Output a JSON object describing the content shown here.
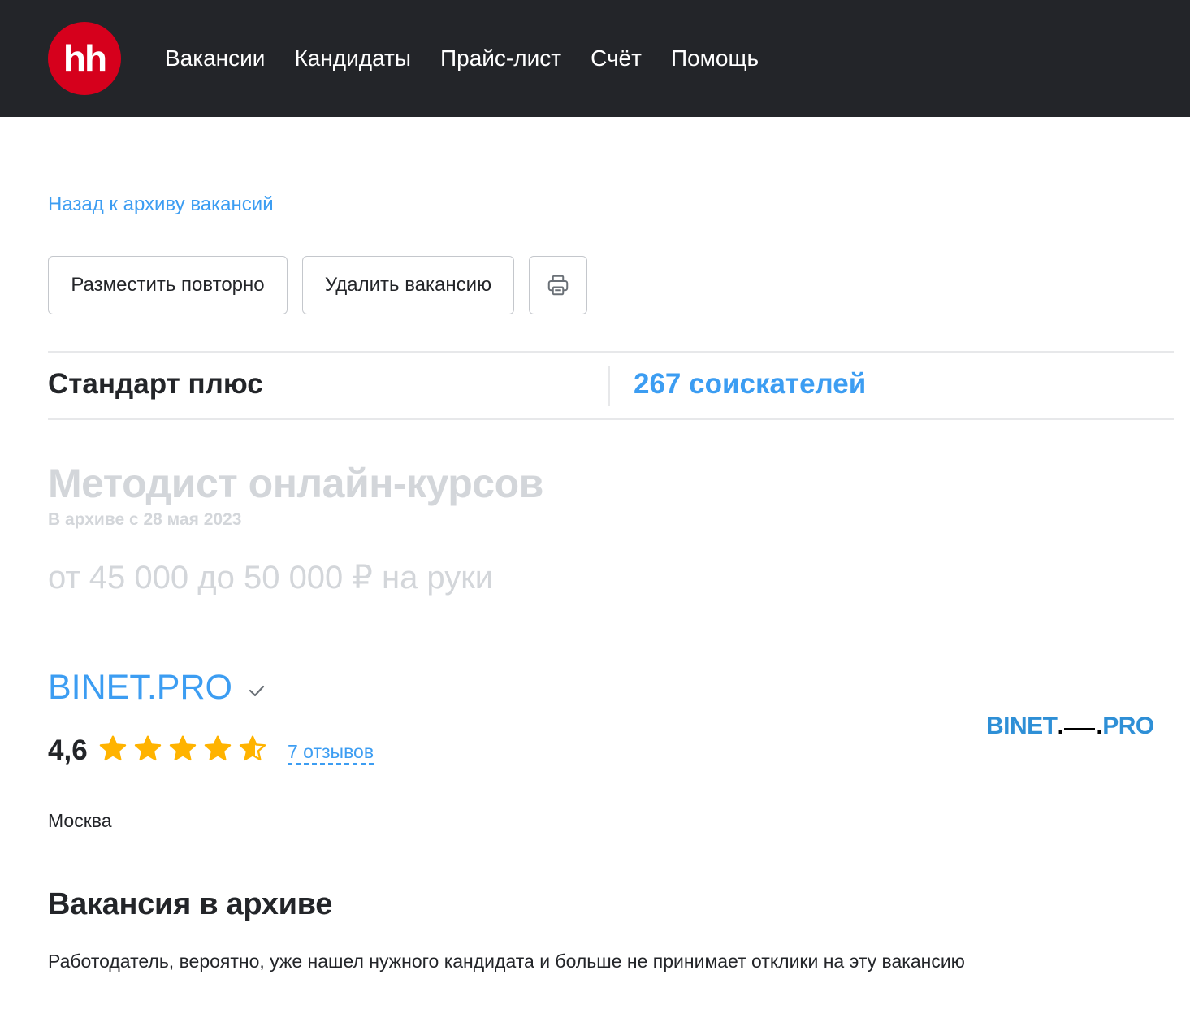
{
  "header": {
    "logo_text": "hh",
    "nav": [
      "Вакансии",
      "Кандидаты",
      "Прайс-лист",
      "Счёт",
      "Помощь"
    ]
  },
  "back_link": "Назад к архиву вакансий",
  "actions": {
    "repost": "Разместить повторно",
    "delete": "Удалить вакансию",
    "print_icon": "printer-icon"
  },
  "tariff": {
    "name": "Стандарт плюс",
    "applicants": "267 соискателей"
  },
  "vacancy": {
    "title": "Методист онлайн-курсов",
    "archive_date": "В архиве с 28 мая 2023",
    "salary": "от 45 000 до 50 000 ₽ на руки"
  },
  "company": {
    "name": "BINET.PRO",
    "verified_icon": "checkmark-icon",
    "rating": "4,6",
    "rating_value": 4.6,
    "stars_max": 5,
    "reviews": "7 отзывов",
    "logo_left": "BINET",
    "logo_right": "PRO",
    "city": "Москва"
  },
  "archive_notice": {
    "heading": "Вакансия в архиве",
    "text": "Работодатель, вероятно, уже нашел нужного кандидата и больше не принимает отклики на эту вакансию"
  },
  "colors": {
    "header_bg": "#232529",
    "logo_red": "#d6001c",
    "link_blue": "#3c9df2",
    "star_gold": "#ffb300",
    "muted": "#d3d6da"
  }
}
